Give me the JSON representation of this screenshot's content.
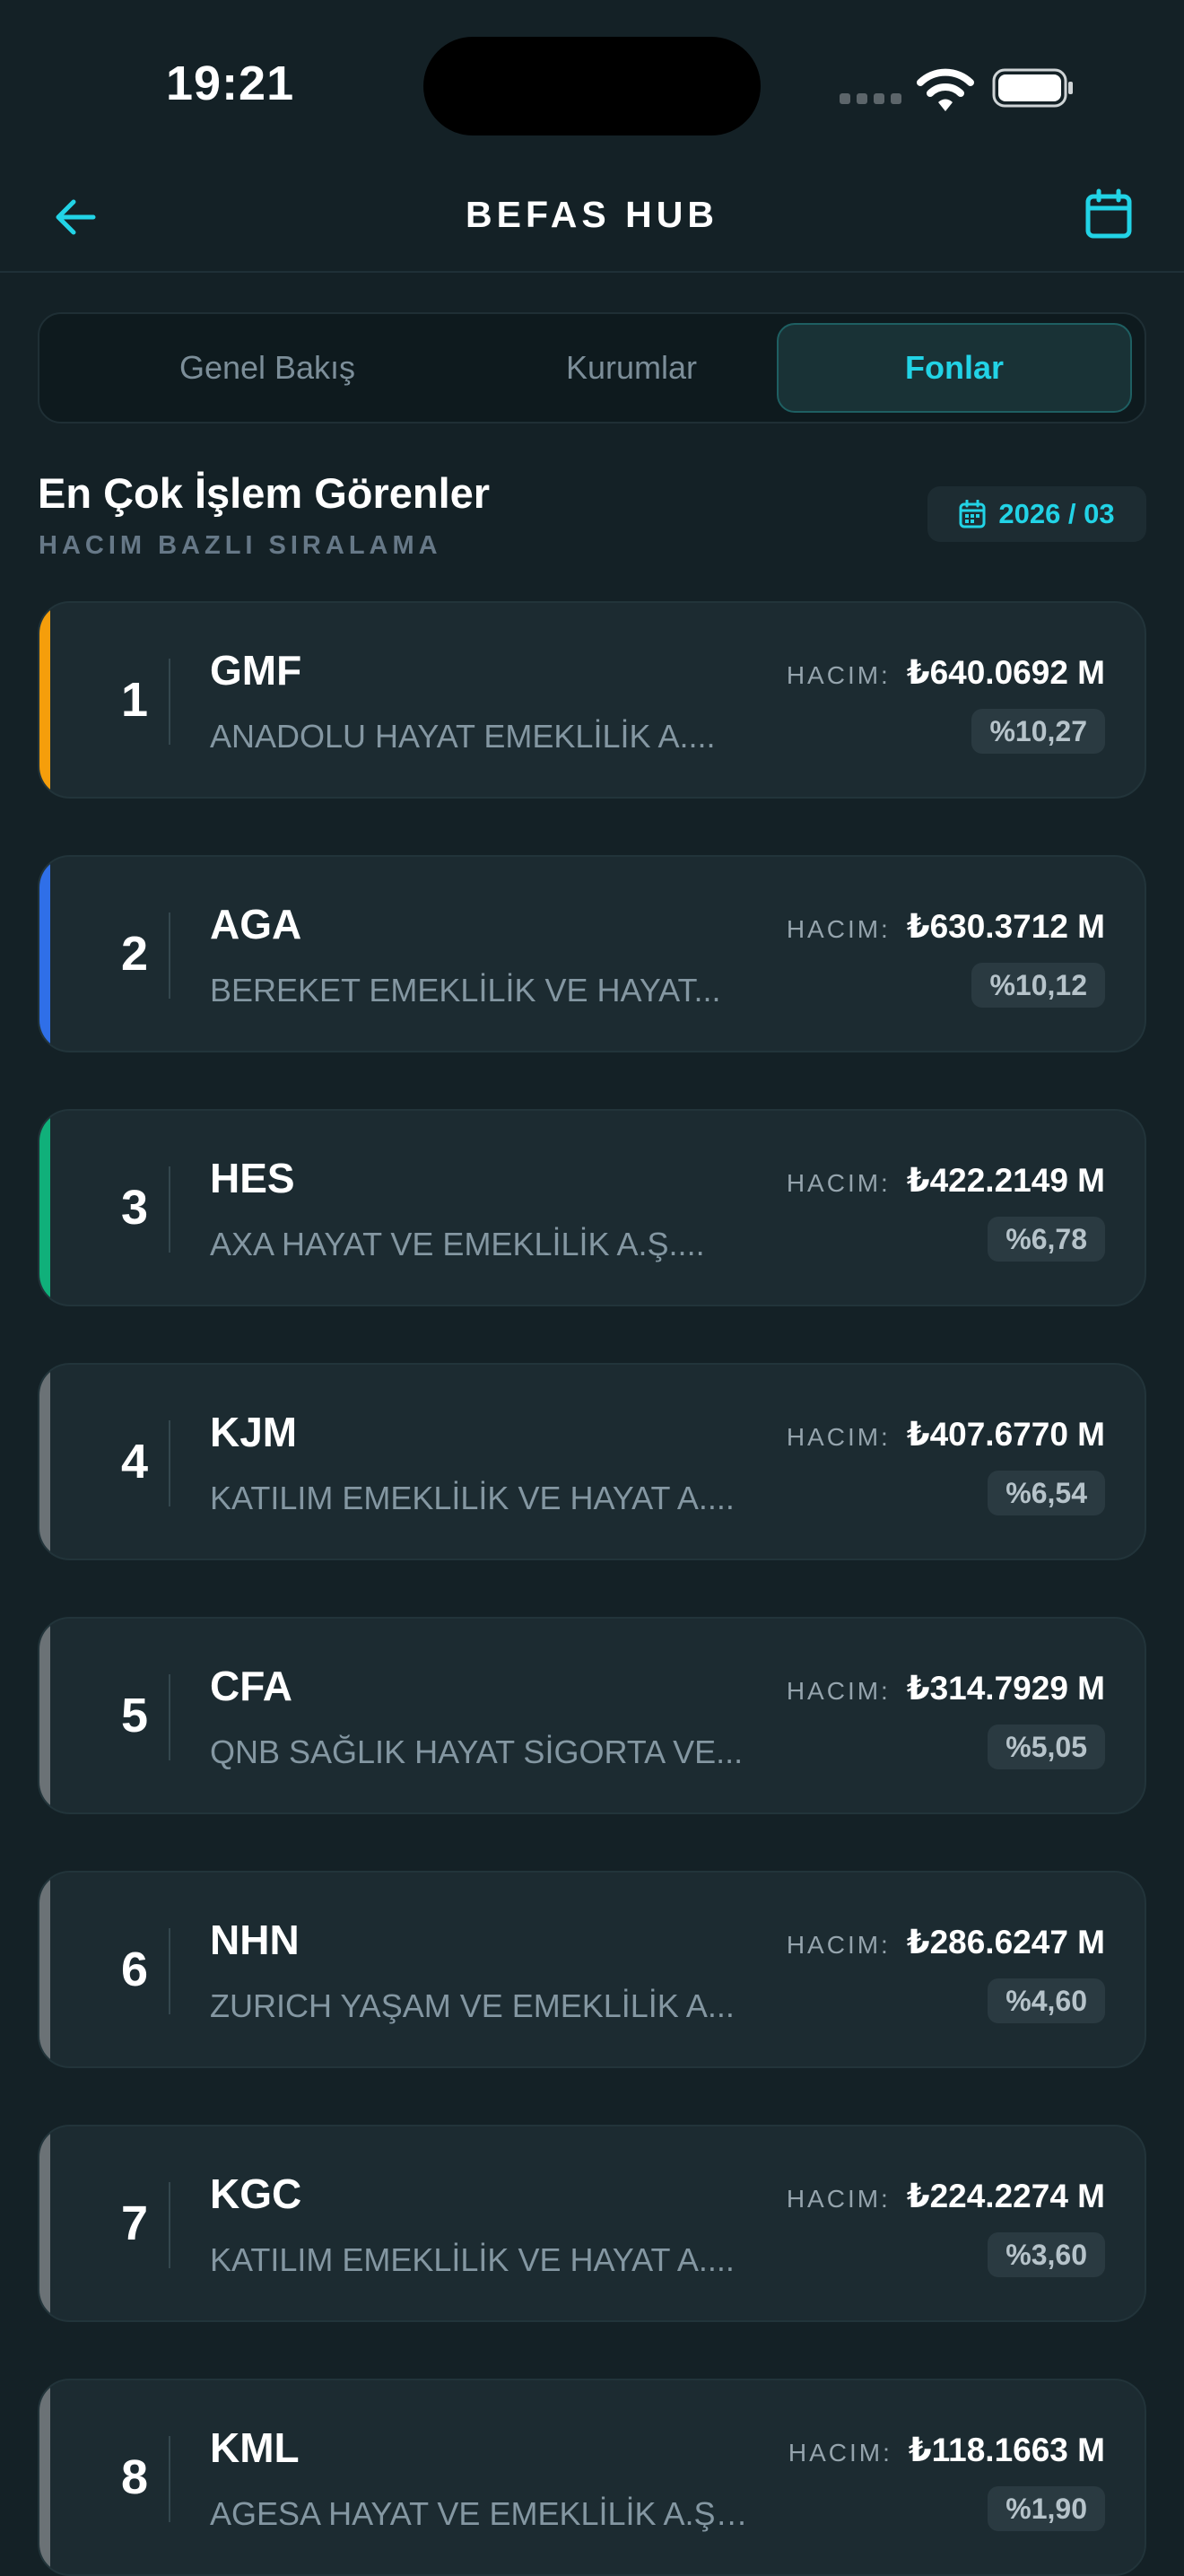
{
  "status_bar": {
    "time": "19:21"
  },
  "nav": {
    "title": "BEFAS HUB",
    "back_icon": "arrow-left-icon",
    "calendar_icon": "calendar-icon"
  },
  "tabs": [
    {
      "label": "Genel Bakış",
      "active": false
    },
    {
      "label": "Kurumlar",
      "active": false
    },
    {
      "label": "Fonlar",
      "active": true
    }
  ],
  "section": {
    "title": "En Çok İşlem Görenler",
    "subtitle": "HACIM BAZLI SIRALAMA",
    "date": "2026 / 03"
  },
  "colors": {
    "accent": "#22d3e6",
    "gold": "#f59e0b",
    "blue": "#2f6fe8",
    "green": "#10b07a",
    "gray": "#6b7276"
  },
  "volume_label": "HACIM:",
  "funds": [
    {
      "rank": "1",
      "code": "GMF",
      "name": "ANADOLU HAYAT EMEKLİLİK A....",
      "volume": "₺640.0692 M",
      "share": "%10,27",
      "accent": "#f59e0b"
    },
    {
      "rank": "2",
      "code": "AGA",
      "name": "BEREKET EMEKLİLİK VE HAYAT...",
      "volume": "₺630.3712 M",
      "share": "%10,12",
      "accent": "#2f6fe8"
    },
    {
      "rank": "3",
      "code": "HES",
      "name": "AXA HAYAT VE EMEKLİLİK A.Ş....",
      "volume": "₺422.2149 M",
      "share": "%6,78",
      "accent": "#10b07a"
    },
    {
      "rank": "4",
      "code": "KJM",
      "name": "KATILIM EMEKLİLİK VE HAYAT A....",
      "volume": "₺407.6770 M",
      "share": "%6,54",
      "accent": "#6b7276"
    },
    {
      "rank": "5",
      "code": "CFA",
      "name": "QNB SAĞLIK HAYAT SİGORTA VE...",
      "volume": "₺314.7929 M",
      "share": "%5,05",
      "accent": "#6b7276"
    },
    {
      "rank": "6",
      "code": "NHN",
      "name": "ZURICH YAŞAM VE EMEKLİLİK A...",
      "volume": "₺286.6247 M",
      "share": "%4,60",
      "accent": "#6b7276"
    },
    {
      "rank": "7",
      "code": "KGC",
      "name": "KATILIM EMEKLİLİK VE HAYAT A....",
      "volume": "₺224.2274 M",
      "share": "%3,60",
      "accent": "#6b7276"
    },
    {
      "rank": "8",
      "code": "KML",
      "name": "AGESA HAYAT VE EMEKLİLİK A.Ş....",
      "volume": "₺118.1663 M",
      "share": "%1,90",
      "accent": "#6b7276"
    }
  ]
}
